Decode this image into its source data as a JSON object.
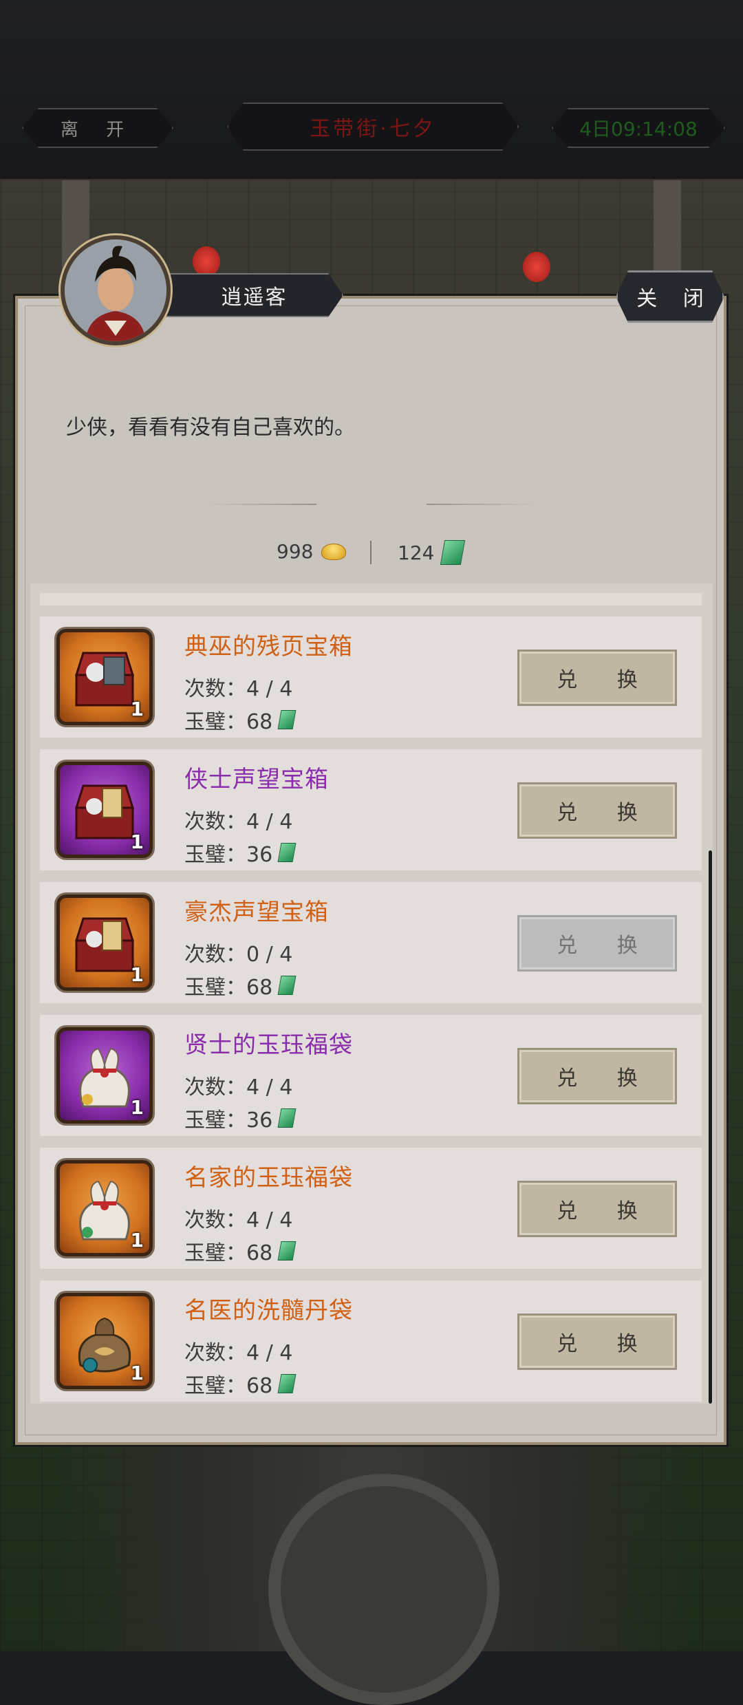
{
  "top_bar": {
    "leave_label": "离 开",
    "location": "玉带街·七夕",
    "timer": "4日09:14:08"
  },
  "npc": {
    "name": "逍遥客",
    "dialog": "少侠，看看有没有自己喜欢的。"
  },
  "close_label": "关 闭",
  "currency": {
    "gold": "998",
    "jade": "124"
  },
  "items": [
    {
      "name": "典巫的残页宝箱",
      "count": "次数：4 / 4",
      "price": "玉璧：68",
      "qty": "1",
      "rarity": "orange",
      "art": "chest-book",
      "button": "兑 换",
      "enabled": true
    },
    {
      "name": "侠士声望宝箱",
      "count": "次数：4 / 4",
      "price": "玉璧：36",
      "qty": "1",
      "rarity": "purple",
      "art": "chest-token",
      "button": "兑 换",
      "enabled": true
    },
    {
      "name": "豪杰声望宝箱",
      "count": "次数：0 / 4",
      "price": "玉璧：68",
      "qty": "1",
      "rarity": "orange",
      "art": "chest-token",
      "button": "兑 换",
      "enabled": false
    },
    {
      "name": "贤士的玉珏福袋",
      "count": "次数：4 / 4",
      "price": "玉璧：36",
      "qty": "1",
      "rarity": "purple",
      "art": "lucky-bag",
      "button": "兑 换",
      "enabled": true
    },
    {
      "name": "名家的玉珏福袋",
      "count": "次数：4 / 4",
      "price": "玉璧：68",
      "qty": "1",
      "rarity": "orange",
      "art": "lucky-bag",
      "button": "兑 换",
      "enabled": true
    },
    {
      "name": "名医的洗髓丹袋",
      "count": "次数：4 / 4",
      "price": "玉璧：68",
      "qty": "1",
      "rarity": "orange",
      "art": "pill-pouch",
      "button": "兑 换",
      "enabled": true
    }
  ],
  "colors": {
    "orange_rarity": "#d06013",
    "purple_rarity": "#8a2cab",
    "panel_bg": "#cac4bf"
  }
}
